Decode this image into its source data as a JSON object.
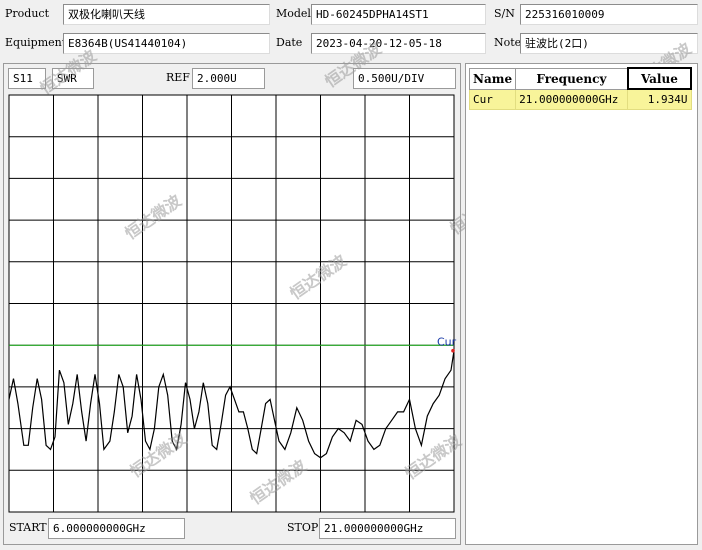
{
  "header": {
    "product_label": "Product",
    "product_value": "双极化喇叭天线",
    "model_label": "Model",
    "model_value": "HD-60245DPHA14ST1",
    "sn_label": "S/N",
    "sn_value": "225316010009",
    "equipment_label": "Equipment",
    "equipment_value": "E8364B(US41440104)",
    "date_label": "Date",
    "date_value": "2023-04-20-12-05-18",
    "note_label": "Note",
    "note_value": "驻波比(2口)"
  },
  "plot": {
    "param": "S11",
    "format": "SWR",
    "ref_label": "REF",
    "ref_value": "2.000U",
    "scale_value": "0.500U/DIV",
    "start_label": "START",
    "start_value": "6.000000000GHz",
    "stop_label": "STOP",
    "stop_value": "21.000000000GHz",
    "marker_label": "Cur",
    "colors": {
      "trace": "#000000",
      "ref_line": "#22bb22",
      "marker": "#1a3aa8",
      "marker_dot": "#dd2222",
      "grid": "#000000"
    }
  },
  "marker_table": {
    "headers": [
      "Name",
      "Frequency",
      "Value"
    ],
    "rows": [
      {
        "name": "Cur",
        "frequency": "21.000000000GHz",
        "value": "1.934U"
      }
    ]
  },
  "watermark": {
    "text": "恒达微波"
  },
  "chart_data": {
    "type": "line",
    "xlabel": "",
    "ylabel": "",
    "xlim": [
      6,
      21
    ],
    "ylim": [
      0,
      5
    ],
    "grid": true,
    "reference_level": 2.0,
    "series": [
      {
        "x": [
          6.0,
          6.15,
          6.3,
          6.5,
          6.65,
          6.8,
          6.95,
          7.1,
          7.25,
          7.4,
          7.55,
          7.7,
          7.85,
          8.0,
          8.15,
          8.3,
          8.45,
          8.6,
          8.75,
          8.9,
          9.05,
          9.2,
          9.4,
          9.55,
          9.7,
          9.85,
          10.0,
          10.15,
          10.3,
          10.45,
          10.6,
          10.75,
          10.9,
          11.05,
          11.2,
          11.35,
          11.5,
          11.65,
          11.8,
          11.95,
          12.1,
          12.25,
          12.4,
          12.55,
          12.7,
          12.85,
          13.0,
          13.15,
          13.3,
          13.45,
          13.6,
          13.75,
          13.9,
          14.05,
          14.2,
          14.35,
          14.5,
          14.65,
          14.8,
          14.95,
          15.1,
          15.3,
          15.5,
          15.7,
          15.9,
          16.1,
          16.3,
          16.5,
          16.7,
          16.9,
          17.1,
          17.3,
          17.5,
          17.7,
          17.9,
          18.1,
          18.3,
          18.5,
          18.7,
          18.9,
          19.1,
          19.3,
          19.5,
          19.7,
          19.9,
          20.1,
          20.3,
          20.5,
          20.7,
          20.9,
          21.0
        ],
        "y": [
          1.35,
          1.6,
          1.3,
          0.8,
          0.8,
          1.25,
          1.6,
          1.35,
          0.8,
          0.75,
          0.9,
          1.7,
          1.55,
          1.05,
          1.3,
          1.65,
          1.2,
          0.85,
          1.3,
          1.65,
          1.3,
          0.75,
          0.85,
          1.2,
          1.65,
          1.5,
          0.95,
          1.15,
          1.65,
          1.35,
          0.85,
          0.75,
          1.0,
          1.5,
          1.65,
          1.4,
          0.85,
          0.75,
          1.05,
          1.55,
          1.35,
          1.0,
          1.2,
          1.55,
          1.3,
          0.8,
          0.75,
          1.05,
          1.4,
          1.5,
          1.35,
          1.2,
          1.2,
          1.0,
          0.75,
          0.7,
          1.0,
          1.3,
          1.35,
          1.1,
          0.85,
          0.75,
          0.95,
          1.25,
          1.1,
          0.85,
          0.7,
          0.65,
          0.7,
          0.9,
          1.0,
          0.95,
          0.85,
          1.1,
          1.05,
          0.85,
          0.75,
          0.8,
          1.0,
          1.1,
          1.2,
          1.2,
          1.35,
          1.0,
          0.8,
          1.15,
          1.3,
          1.4,
          1.6,
          1.7,
          1.934
        ]
      }
    ]
  }
}
